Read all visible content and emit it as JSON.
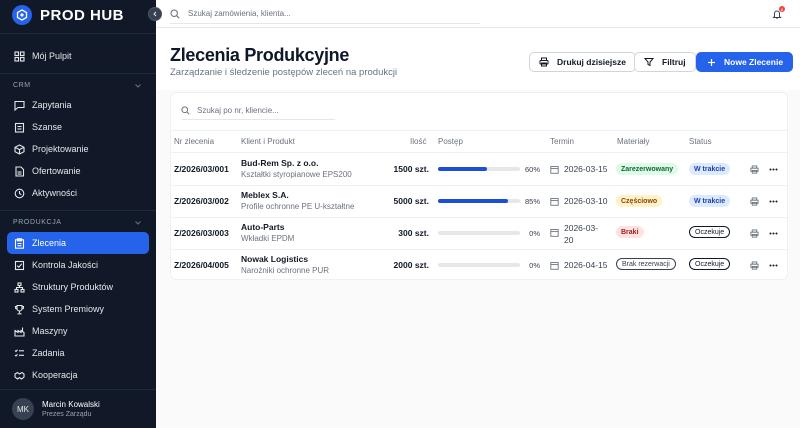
{
  "app": {
    "brand": "PROD HUB",
    "accent": "#2563eb"
  },
  "sidebar": {
    "top_item": {
      "label": "Mój Pulpit",
      "icon": "grid-icon"
    },
    "sections": [
      {
        "label": "CRM",
        "items": [
          {
            "label": "Zapytania",
            "icon": "message-icon"
          },
          {
            "label": "Szanse",
            "icon": "clipboard-icon"
          },
          {
            "label": "Projektowanie",
            "icon": "cube-icon"
          },
          {
            "label": "Ofertowanie",
            "icon": "document-icon"
          },
          {
            "label": "Aktywności",
            "icon": "activity-icon"
          }
        ]
      },
      {
        "label": "PRODUKCJA",
        "items": [
          {
            "label": "Zlecenia",
            "icon": "clipboard-list-icon",
            "active": true
          },
          {
            "label": "Kontrola Jakości",
            "icon": "checklist-icon"
          },
          {
            "label": "Struktury Produktów",
            "icon": "hierarchy-icon"
          },
          {
            "label": "System Premiowy",
            "icon": "trophy-icon"
          },
          {
            "label": "Maszyny",
            "icon": "factory-icon"
          },
          {
            "label": "Zadania",
            "icon": "tasks-icon"
          },
          {
            "label": "Kooperacja",
            "icon": "handshake-icon"
          }
        ]
      }
    ],
    "user": {
      "initials": "MK",
      "name": "Marcin Kowalski",
      "role": "Prezes Zarządu"
    }
  },
  "topbar": {
    "search_placeholder": "Szukaj zamówienia, klienta...",
    "notification_count": "8"
  },
  "header": {
    "title": "Zlecenia Produkcyjne",
    "subtitle": "Zarządzanie i śledzenie postępów zleceń na produkcji",
    "print_label": "Drukuj dzisiejsze",
    "filter_label": "Filtruj",
    "new_label": "Nowe Zlecenie"
  },
  "table": {
    "search_placeholder": "Szukaj po nr, kliencie...",
    "columns": [
      "Nr zlecenia",
      "Klient i Produkt",
      "Ilość",
      "Postęp",
      "Termin",
      "Materiały",
      "Status"
    ],
    "rows": [
      {
        "order": "Z/2026/03/001",
        "client": "Bud-Rem Sp. z o.o.",
        "product": "Kształtki styropianowe EPS200",
        "qty": "1500 szt.",
        "progress": 60,
        "progress_label": "60%",
        "deadline": "2026-03-15",
        "materials": "Zarezerwowany",
        "materials_style": "green",
        "status": "W trakcie",
        "status_style": "blue"
      },
      {
        "order": "Z/2026/03/002",
        "client": "Meblex S.A.",
        "product": "Profile ochronne PE U-kształtne",
        "qty": "5000 szt.",
        "progress": 85,
        "progress_label": "85%",
        "deadline": "2026-03-10",
        "materials": "Częściowo",
        "materials_style": "yellow",
        "status": "W trakcie",
        "status_style": "blue"
      },
      {
        "order": "Z/2026/03/003",
        "client": "Auto-Parts",
        "product": "Wkładki EPDM",
        "qty": "300 szt.",
        "progress": 0,
        "progress_label": "0%",
        "deadline": "2026-03-20",
        "materials": "Braki",
        "materials_style": "red",
        "status": "Oczekuje",
        "status_style": "outline"
      },
      {
        "order": "Z/2026/04/005",
        "client": "Nowak Logistics",
        "product": "Narożniki ochronne PUR",
        "qty": "2000 szt.",
        "progress": 0,
        "progress_label": "0%",
        "deadline": "2026-04-15",
        "materials": "Brak rezerwacji",
        "materials_style": "outline",
        "status": "Oczekuje",
        "status_style": "outline"
      }
    ]
  }
}
